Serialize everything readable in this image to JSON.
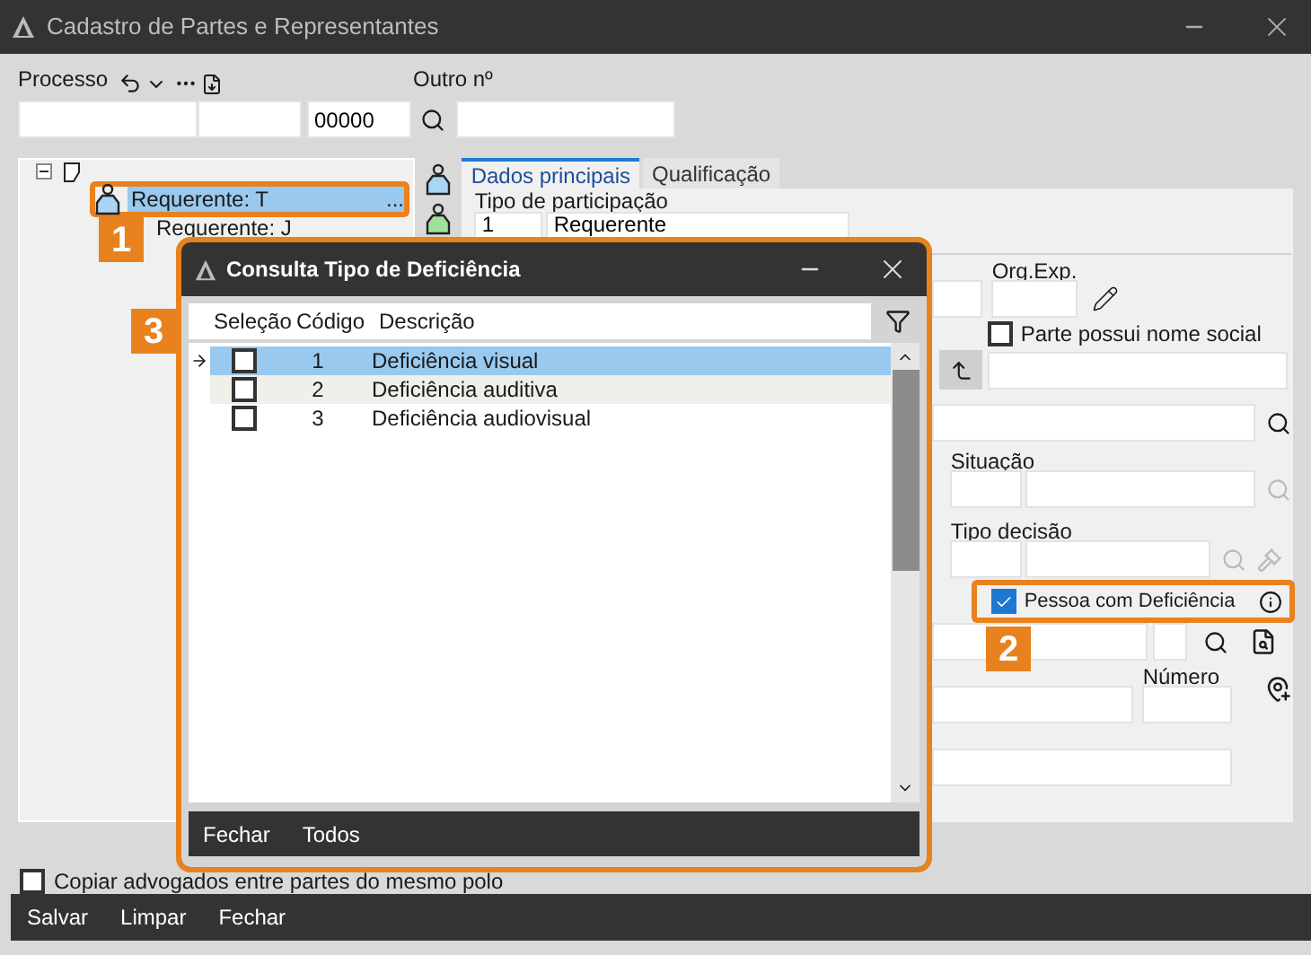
{
  "window": {
    "title": "Cadastro de Partes e Representantes"
  },
  "process": {
    "label": "Processo",
    "suffix": "00000"
  },
  "other_number": {
    "label": "Outro nº"
  },
  "tree": {
    "items": [
      {
        "expanded": true,
        "children": [
          {
            "label": "Requerente: T",
            "ellipsis": "...",
            "selected": true
          },
          {
            "label": "Requerente: J",
            "selected": false
          }
        ]
      }
    ]
  },
  "tabs": [
    {
      "label": "Dados principais",
      "selected": true
    },
    {
      "label": "Qualificação",
      "selected": false
    }
  ],
  "form": {
    "participation": {
      "label": "Tipo de participação",
      "code": "1",
      "value": "Requerente"
    },
    "org_exp": {
      "label": "Org.Exp."
    },
    "social_name": {
      "label": "Parte possui nome social",
      "checked": false
    },
    "situation": {
      "label": "Situação"
    },
    "decision_type": {
      "label": "Tipo decisão"
    },
    "disability": {
      "label": "Pessoa com Deficiência",
      "checked": true
    },
    "number": {
      "label": "Número"
    }
  },
  "copy_lawyers": {
    "label": "Copiar advogados entre partes do mesmo polo",
    "checked": false
  },
  "footer_buttons": [
    "Salvar",
    "Limpar",
    "Fechar"
  ],
  "dialog": {
    "title": "Consulta Tipo de Deficiência",
    "columns": [
      "Seleção",
      "Código",
      "Descrição"
    ],
    "rows": [
      {
        "code": "1",
        "description": "Deficiência visual",
        "checked": false,
        "selected": true
      },
      {
        "code": "2",
        "description": "Deficiência auditiva",
        "checked": false,
        "selected": false
      },
      {
        "code": "3",
        "description": "Deficiência audiovisual",
        "checked": false,
        "selected": false
      }
    ],
    "buttons": [
      "Fechar",
      "Todos"
    ]
  },
  "callouts": [
    "1",
    "2",
    "3"
  ]
}
